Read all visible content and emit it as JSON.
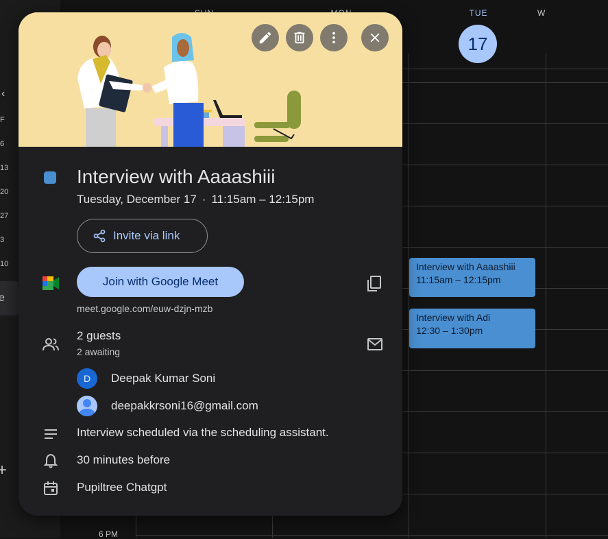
{
  "calendar": {
    "days": [
      {
        "name": "SUN"
      },
      {
        "name": "MON"
      },
      {
        "name": "TUE",
        "date": "17"
      },
      {
        "name": "W"
      }
    ],
    "mini_days": [
      "F",
      "6",
      "13",
      "20",
      "27",
      "3",
      "10"
    ],
    "rail_selected_label": "e",
    "rail_plus": "+",
    "time_label": "6 PM",
    "events": [
      {
        "title": "Interview with Aaaashiii",
        "time": "11:15am – 12:15pm"
      },
      {
        "title": "Interview with Adi",
        "time": "12:30 – 1:30pm"
      }
    ]
  },
  "popover": {
    "header_buttons": [
      {
        "name": "edit",
        "icon": "pencil-icon"
      },
      {
        "name": "delete",
        "icon": "trash-icon"
      },
      {
        "name": "more",
        "icon": "more-vert-icon"
      },
      {
        "name": "close",
        "icon": "close-icon"
      }
    ],
    "event": {
      "title": "Interview with Aaaashiii",
      "date": "Tuesday, December 17",
      "separator": "·",
      "time": "11:15am – 12:15pm",
      "color": "#4a8fd1"
    },
    "invite_label": "Invite via link",
    "meet": {
      "join_label": "Join with Google Meet",
      "link": "meet.google.com/euw-dzjn-mzb"
    },
    "guests": {
      "count_label": "2 guests",
      "awaiting_label": "2 awaiting",
      "list": [
        {
          "name": "Deepak Kumar Soni",
          "initial": "D"
        },
        {
          "name": "deepakkrsoni16@gmail.com",
          "initial": ""
        }
      ]
    },
    "description": "Interview scheduled via the scheduling assistant.",
    "reminder": "30 minutes before",
    "calendar_name": "Pupiltree Chatgpt"
  }
}
